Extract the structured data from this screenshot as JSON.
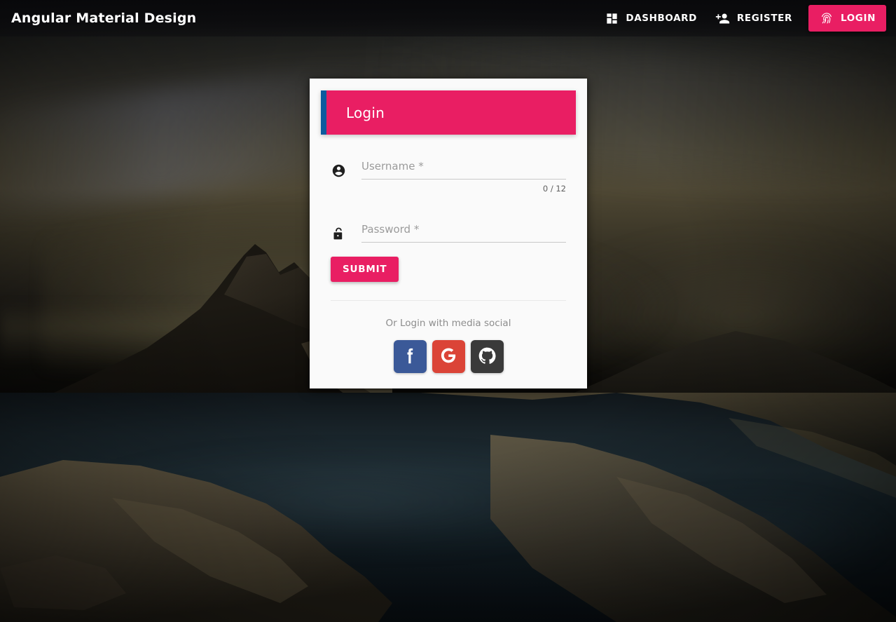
{
  "navbar": {
    "brand": "Angular Material Design",
    "items": [
      {
        "label": "DASHBOARD",
        "icon": "dashboard-icon",
        "style": "flat"
      },
      {
        "label": "REGISTER",
        "icon": "person-add-icon",
        "style": "flat"
      },
      {
        "label": "LOGIN",
        "icon": "fingerprint-icon",
        "style": "raised"
      }
    ]
  },
  "card": {
    "title": "Login",
    "accent_color": "#e91e63",
    "accent_bar_color": "#0d5b9e",
    "fields": [
      {
        "name": "username",
        "label": "Username",
        "required_marker": "*",
        "value": "",
        "placeholder": "Username *",
        "icon": "account-circle-icon",
        "counter": "0 / 12"
      },
      {
        "name": "password",
        "label": "Password",
        "required_marker": "*",
        "value": "",
        "placeholder": "Password *",
        "icon": "lock-open-icon",
        "counter": ""
      }
    ],
    "submit_label": "SUBMIT",
    "social_caption": "Or Login with media social",
    "social_buttons": [
      {
        "name": "facebook",
        "icon": "facebook-icon",
        "color": "#3b5998"
      },
      {
        "name": "google",
        "icon": "google-icon",
        "color": "#db4437"
      },
      {
        "name": "github",
        "icon": "github-icon",
        "color": "#3a3a3a"
      }
    ]
  }
}
